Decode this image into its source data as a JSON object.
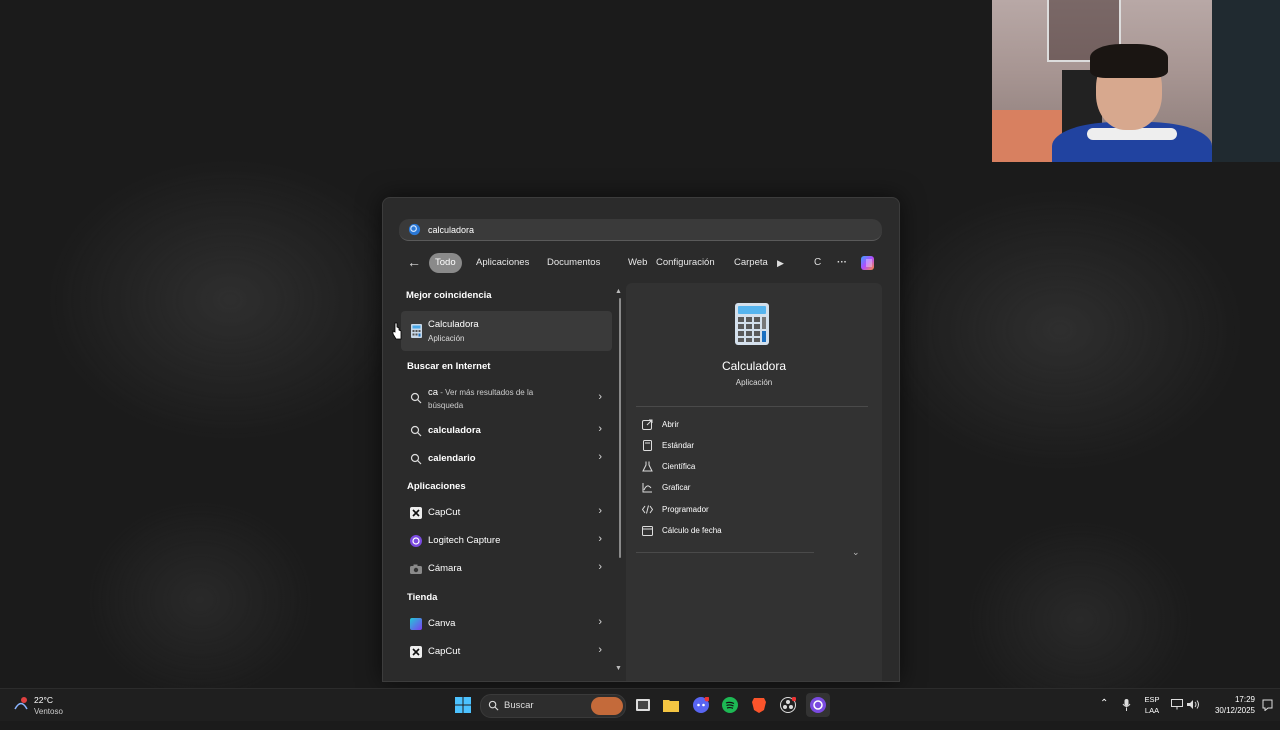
{
  "search": {
    "query": "calculadora"
  },
  "filters": {
    "tabs": [
      {
        "label": "Todo",
        "active": true
      },
      {
        "label": "Aplicaciones"
      },
      {
        "label": "Documentos"
      },
      {
        "label": "Web"
      },
      {
        "label": "Configuración"
      },
      {
        "label": "Carpeta"
      }
    ],
    "extra_letter": "C",
    "more": "···"
  },
  "results": {
    "best_match_heading": "Mejor coincidencia",
    "best_match": {
      "name": "Calculadora",
      "type": "Aplicación"
    },
    "web_heading": "Buscar en Internet",
    "web": [
      {
        "strong": "ca",
        "rest": " - Ver más resultados de la",
        "rest2": "búsqueda"
      },
      {
        "strong": "calculadora"
      },
      {
        "strong": "calendario"
      }
    ],
    "apps_heading": "Aplicaciones",
    "apps": [
      "CapCut",
      "Logitech Capture",
      "Cámara"
    ],
    "store_heading": "Tienda",
    "store": [
      "Canva",
      "CapCut"
    ]
  },
  "preview": {
    "name": "Calculadora",
    "type": "Aplicación",
    "actions": [
      "Abrir",
      "Estándar",
      "Científica",
      "Graficar",
      "Programador",
      "Cálculo de fecha"
    ]
  },
  "taskbar": {
    "temperature": "22°C",
    "condition": "Ventoso",
    "search_label": "Buscar",
    "lang1": "ESP",
    "lang2": "LAA",
    "time": "17:29",
    "date": "30/12/2025"
  },
  "colors": {
    "accent_blue": "#0078d4",
    "panel_bg": "#2b2b2b",
    "preview_bg": "#323232",
    "active_chip": "#8a8a8a"
  }
}
